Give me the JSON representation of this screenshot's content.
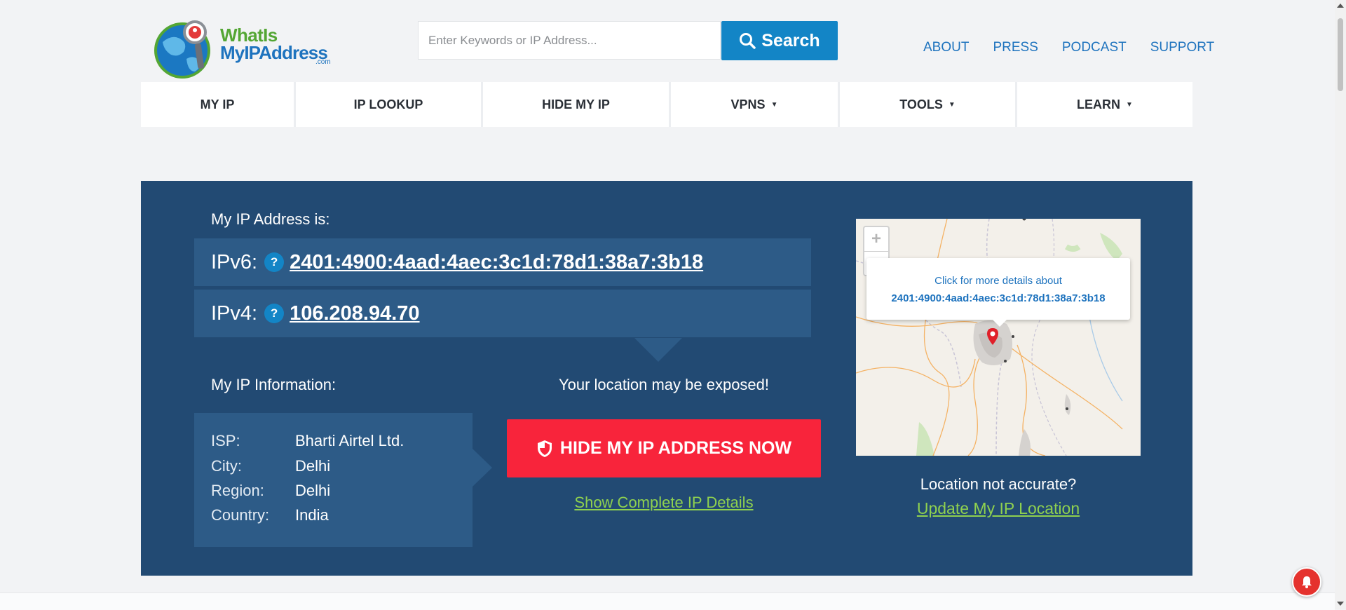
{
  "header": {
    "logo": {
      "line1": "WhatIs",
      "line2": "MyIPAddress",
      "domain": ".com"
    },
    "search": {
      "placeholder": "Enter Keywords or IP Address...",
      "button_label": "Search",
      "button_icon": "search-icon"
    },
    "top_links": [
      "ABOUT",
      "PRESS",
      "PODCAST",
      "SUPPORT"
    ]
  },
  "nav": {
    "items": [
      {
        "label": "MY IP",
        "dropdown": false
      },
      {
        "label": "IP LOOKUP",
        "dropdown": false
      },
      {
        "label": "HIDE MY IP",
        "dropdown": false
      },
      {
        "label": "VPNS",
        "dropdown": true
      },
      {
        "label": "TOOLS",
        "dropdown": true
      },
      {
        "label": "LEARN",
        "dropdown": true
      }
    ],
    "caret": "▼"
  },
  "hero": {
    "ip_heading": "My IP Address is:",
    "ipv6": {
      "label": "IPv6:",
      "help": "?",
      "value": "2401:4900:4aad:4aec:3c1d:78d1:38a7:3b18"
    },
    "ipv4": {
      "label": "IPv4:",
      "help": "?",
      "value": "106.208.94.70"
    },
    "info_heading": "My IP Information:",
    "info": [
      {
        "key": "ISP:",
        "value": "Bharti Airtel Ltd."
      },
      {
        "key": "City:",
        "value": "Delhi"
      },
      {
        "key": "Region:",
        "value": "Delhi"
      },
      {
        "key": "Country:",
        "value": "India"
      }
    ],
    "exposed_text": "Your location may be exposed!",
    "hide_button": "HIDE MY IP ADDRESS NOW",
    "hide_icon": "shield-icon",
    "show_details": "Show Complete IP Details",
    "map": {
      "zoom_in": "+",
      "zoom_out": "−",
      "popup_line1": "Click for more details about",
      "popup_line2": "2401:4900:4aad:4aec:3c1d:78d1:38a7:3b18",
      "marker_icon": "map-pin-icon"
    },
    "not_accurate": "Location not accurate?",
    "update_link": "Update My IP Location"
  },
  "colors": {
    "brand_blue": "#1385c6",
    "hero_bg": "#224a73",
    "panel_bg": "#2d5b87",
    "cta_red": "#f8243b",
    "link_green": "#8fd14f",
    "logo_green": "#54a634"
  }
}
